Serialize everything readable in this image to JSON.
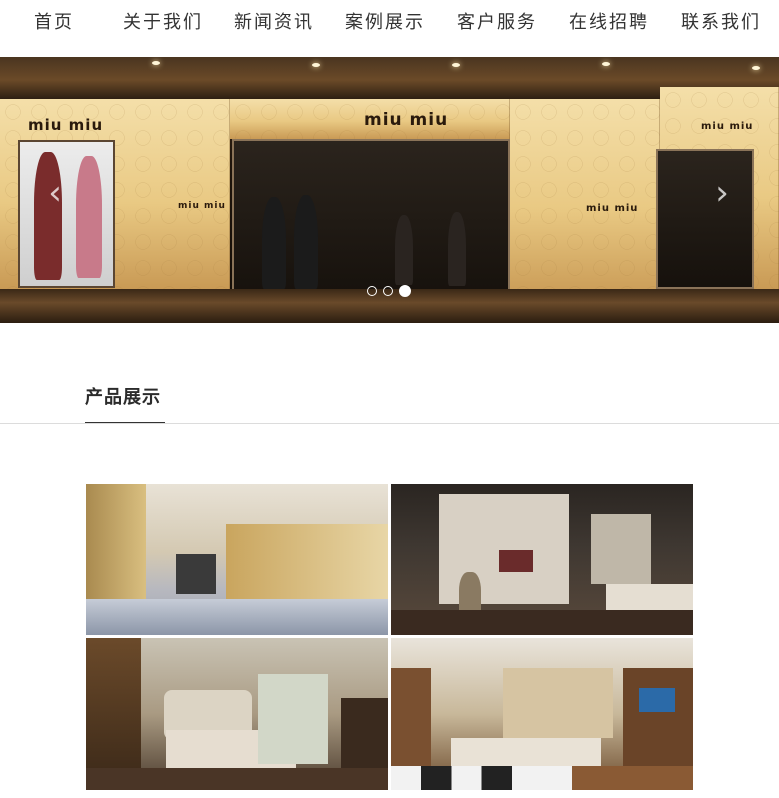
{
  "nav": {
    "items": [
      {
        "label": "首页"
      },
      {
        "label": "关于我们"
      },
      {
        "label": "新闻资讯"
      },
      {
        "label": "案例展示"
      },
      {
        "label": "客户服务"
      },
      {
        "label": "在线招聘"
      },
      {
        "label": "联系我们"
      }
    ]
  },
  "banner": {
    "brand_text": "miu miu",
    "prev_arrow": "‹",
    "next_arrow": "›",
    "slide_count": 3,
    "active_slide": 3
  },
  "section": {
    "title": "产品展示"
  },
  "products": [
    {
      "icon": "interior-photo"
    },
    {
      "icon": "interior-photo"
    },
    {
      "icon": "interior-photo"
    },
    {
      "icon": "interior-photo"
    }
  ]
}
